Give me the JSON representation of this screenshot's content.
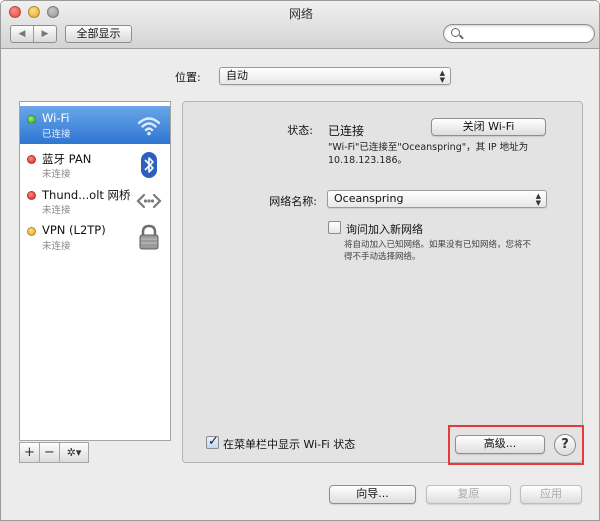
{
  "window": {
    "title": "网络"
  },
  "toolbar": {
    "back_glyph": "◀",
    "forward_glyph": "▶",
    "show_all_label": "全部显示",
    "search_placeholder": ""
  },
  "location": {
    "label": "位置:",
    "value": "自动"
  },
  "services": [
    {
      "name": "Wi-Fi",
      "status": "已连接",
      "dot": "green",
      "icon": "wifi-icon",
      "selected": true
    },
    {
      "name": "蓝牙 PAN",
      "status": "未连接",
      "dot": "red",
      "icon": "bluetooth-icon",
      "selected": false
    },
    {
      "name": "Thund...olt 网桥",
      "status": "未连接",
      "dot": "red",
      "icon": "thunderbolt-bridge-icon",
      "selected": false
    },
    {
      "name": "VPN (L2TP)",
      "status": "未连接",
      "dot": "yellow",
      "icon": "lock-icon",
      "selected": false
    }
  ],
  "sidebar_toolbar": {
    "add": "+",
    "remove": "−",
    "gear": "✲▾"
  },
  "detail": {
    "status_label": "状态:",
    "status_value": "已连接",
    "wifi_off_button": "关闭 Wi-Fi",
    "status_desc_line1": "\"Wi-Fi\"已连接至\"Oceanspring\"，其 IP 地址为",
    "status_desc_line2": "10.18.123.186。",
    "network_name_label": "网络名称:",
    "network_name_value": "Oceanspring",
    "ask_join_label": "询问加入新网络",
    "ask_join_desc_line1": "将自动加入已知网络。如果没有已知网络，您将不",
    "ask_join_desc_line2": "得不手动选择网络。",
    "show_menubar_label": "在菜单栏中显示 Wi-Fi 状态",
    "advanced_button": "高级...",
    "help_glyph": "?"
  },
  "footer": {
    "assistant_button": "向导...",
    "revert_button": "复原",
    "apply_button": "应用"
  },
  "colors": {
    "selection": "#3a7fd5",
    "highlight_box": "#e53b3b"
  }
}
